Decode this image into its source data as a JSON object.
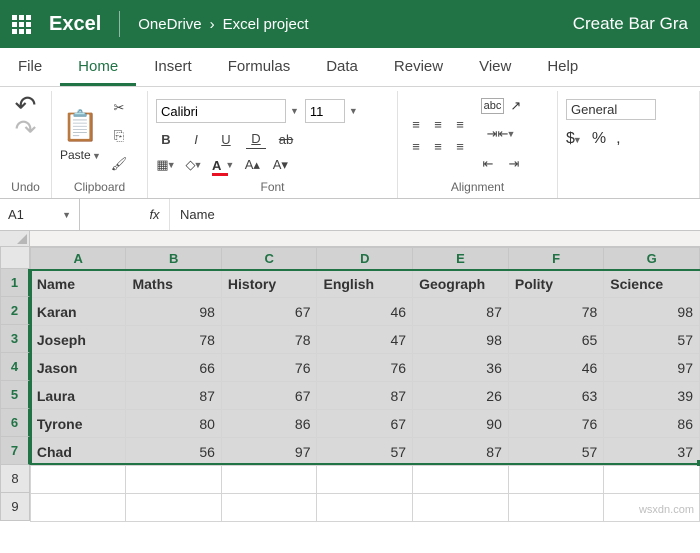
{
  "titlebar": {
    "app": "Excel",
    "path1": "OneDrive",
    "path2": "Excel project",
    "doc": "Create Bar Gra"
  },
  "tabs": {
    "file": "File",
    "home": "Home",
    "insert": "Insert",
    "formulas": "Formulas",
    "data": "Data",
    "review": "Review",
    "view": "View",
    "help": "Help"
  },
  "ribbon": {
    "undo": "Undo",
    "clipboard": "Clipboard",
    "paste": "Paste",
    "font": "Font",
    "font_name": "Calibri",
    "font_size": "11",
    "alignment": "Alignment",
    "numfmt_label": "General",
    "abc": "abc"
  },
  "namebox": "A1",
  "formula": "Name",
  "columns": [
    "A",
    "B",
    "C",
    "D",
    "E",
    "F",
    "G"
  ],
  "rows": [
    "1",
    "2",
    "3",
    "4",
    "5",
    "6",
    "7",
    "8",
    "9"
  ],
  "headers": [
    "Name",
    "Maths",
    "History",
    "English",
    "Geograph",
    "Polity",
    "Science"
  ],
  "data_rows": [
    {
      "name": "Karan",
      "v": [
        98,
        67,
        46,
        87,
        78,
        98
      ]
    },
    {
      "name": "Joseph",
      "v": [
        78,
        78,
        47,
        98,
        65,
        57
      ]
    },
    {
      "name": "Jason",
      "v": [
        66,
        76,
        76,
        36,
        46,
        97
      ]
    },
    {
      "name": "Laura",
      "v": [
        87,
        67,
        87,
        26,
        63,
        39
      ]
    },
    {
      "name": "Tyrone",
      "v": [
        80,
        86,
        67,
        90,
        76,
        86
      ]
    },
    {
      "name": "Chad",
      "v": [
        56,
        97,
        57,
        87,
        57,
        37
      ]
    }
  ],
  "watermark": "wsxdn.com",
  "chart_data": {
    "type": "table",
    "columns": [
      "Name",
      "Maths",
      "History",
      "English",
      "Geography",
      "Polity",
      "Science"
    ],
    "rows": [
      [
        "Karan",
        98,
        67,
        46,
        87,
        78,
        98
      ],
      [
        "Joseph",
        78,
        78,
        47,
        98,
        65,
        57
      ],
      [
        "Jason",
        66,
        76,
        76,
        36,
        46,
        97
      ],
      [
        "Laura",
        87,
        67,
        87,
        26,
        63,
        39
      ],
      [
        "Tyrone",
        80,
        86,
        67,
        90,
        76,
        86
      ],
      [
        "Chad",
        56,
        97,
        57,
        87,
        57,
        37
      ]
    ]
  }
}
